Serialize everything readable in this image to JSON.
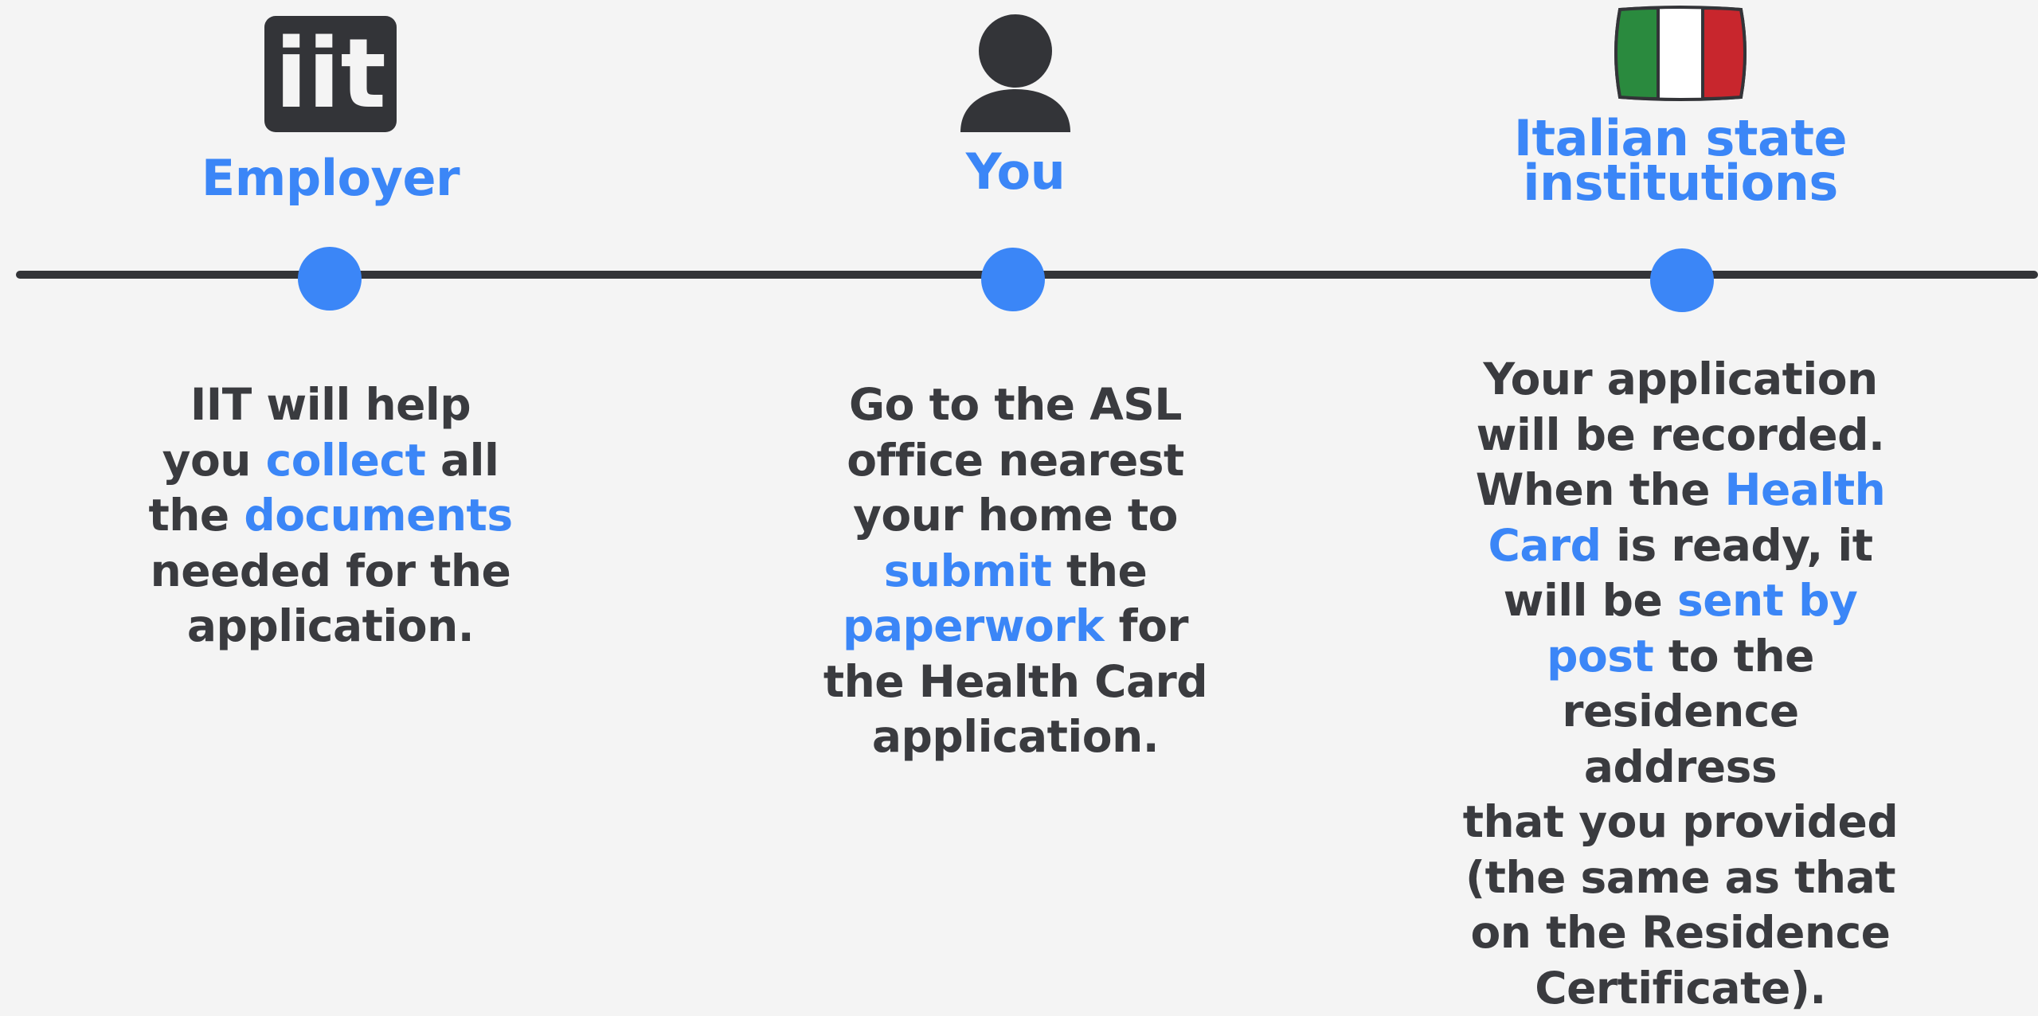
{
  "steps": [
    {
      "title": "Employer",
      "icon": "iit-logo-icon",
      "logo_text": "iit",
      "description": [
        {
          "t": "IIT will help\nyou "
        },
        {
          "t": "collect",
          "hl": true
        },
        {
          "t": " all\nthe "
        },
        {
          "t": "documents",
          "hl": true
        },
        {
          "t": "\nneeded for the\napplication."
        }
      ]
    },
    {
      "title": "You",
      "icon": "person-icon",
      "description": [
        {
          "t": "Go to the ASL\noffice nearest\nyour home to\n"
        },
        {
          "t": "submit",
          "hl": true
        },
        {
          "t": " the\n"
        },
        {
          "t": "paperwork",
          "hl": true
        },
        {
          "t": " for\nthe Health Card\napplication."
        }
      ]
    },
    {
      "title": "Italian state\ninstitutions",
      "icon": "italian-flag-icon",
      "description": [
        {
          "t": "Your application\nwill be recorded.\nWhen the "
        },
        {
          "t": "Health\nCard",
          "hl": true
        },
        {
          "t": " is ready, it\nwill be "
        },
        {
          "t": "sent by\npost",
          "hl": true
        },
        {
          "t": " to the\nresidence address\nthat you provided\n(the same as that\non the Residence\nCertificate)."
        }
      ]
    }
  ],
  "colors": {
    "accent": "#3b86f7",
    "text": "#3a3b3f",
    "line": "#333438",
    "background": "#f4f4f4",
    "flag_green": "#2a8a3e",
    "flag_white": "#ffffff",
    "flag_red": "#c8262d"
  }
}
